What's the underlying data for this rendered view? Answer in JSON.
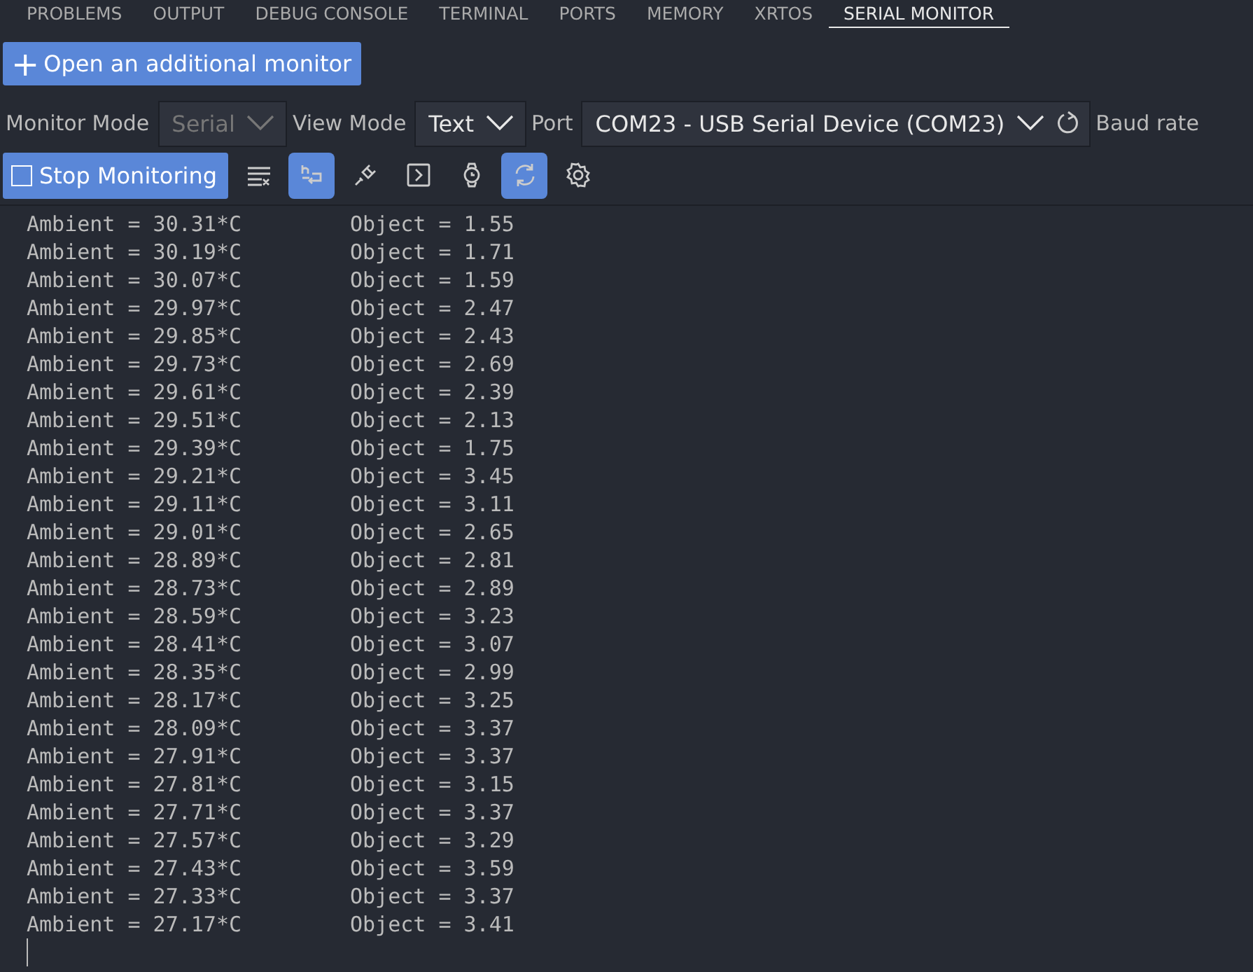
{
  "tabs": [
    {
      "label": "PROBLEMS",
      "selected": false
    },
    {
      "label": "OUTPUT",
      "selected": false
    },
    {
      "label": "DEBUG CONSOLE",
      "selected": false
    },
    {
      "label": "TERMINAL",
      "selected": false
    },
    {
      "label": "PORTS",
      "selected": false
    },
    {
      "label": "MEMORY",
      "selected": false
    },
    {
      "label": "XRTOS",
      "selected": false
    },
    {
      "label": "SERIAL MONITOR",
      "selected": true
    }
  ],
  "open_monitor_button": {
    "icon": "+",
    "label": "Open an additional monitor"
  },
  "settings": [
    {
      "label": "Monitor Mode",
      "value": "Serial",
      "disabled": true
    },
    {
      "label": "View Mode",
      "value": "Text",
      "disabled": false
    },
    {
      "label": "Port",
      "value": "COM23 - USB Serial Device (COM23)",
      "disabled": false,
      "refresh": true
    }
  ],
  "baud_label": "Baud rate",
  "stop_button": {
    "label": "Stop Monitoring"
  },
  "tools": [
    {
      "kind": "clear",
      "on": false
    },
    {
      "kind": "wrap",
      "on": true
    },
    {
      "kind": "plug",
      "on": false
    },
    {
      "kind": "terminal",
      "on": false
    },
    {
      "kind": "watch",
      "on": false
    },
    {
      "kind": "autoscroll",
      "on": true
    },
    {
      "kind": "settings",
      "on": false
    }
  ],
  "output": [
    {
      "ambient": "Ambient = 30.31*C",
      "object": "Object = 1.55"
    },
    {
      "ambient": "Ambient = 30.19*C",
      "object": "Object = 1.71"
    },
    {
      "ambient": "Ambient = 30.07*C",
      "object": "Object = 1.59"
    },
    {
      "ambient": "Ambient = 29.97*C",
      "object": "Object = 2.47"
    },
    {
      "ambient": "Ambient = 29.85*C",
      "object": "Object = 2.43"
    },
    {
      "ambient": "Ambient = 29.73*C",
      "object": "Object = 2.69"
    },
    {
      "ambient": "Ambient = 29.61*C",
      "object": "Object = 2.39"
    },
    {
      "ambient": "Ambient = 29.51*C",
      "object": "Object = 2.13"
    },
    {
      "ambient": "Ambient = 29.39*C",
      "object": "Object = 1.75"
    },
    {
      "ambient": "Ambient = 29.21*C",
      "object": "Object = 3.45"
    },
    {
      "ambient": "Ambient = 29.11*C",
      "object": "Object = 3.11"
    },
    {
      "ambient": "Ambient = 29.01*C",
      "object": "Object = 2.65"
    },
    {
      "ambient": "Ambient = 28.89*C",
      "object": "Object = 2.81"
    },
    {
      "ambient": "Ambient = 28.73*C",
      "object": "Object = 2.89"
    },
    {
      "ambient": "Ambient = 28.59*C",
      "object": "Object = 3.23"
    },
    {
      "ambient": "Ambient = 28.41*C",
      "object": "Object = 3.07"
    },
    {
      "ambient": "Ambient = 28.35*C",
      "object": "Object = 2.99"
    },
    {
      "ambient": "Ambient = 28.17*C",
      "object": "Object = 3.25"
    },
    {
      "ambient": "Ambient = 28.09*C",
      "object": "Object = 3.37"
    },
    {
      "ambient": "Ambient = 27.91*C",
      "object": "Object = 3.37"
    },
    {
      "ambient": "Ambient = 27.81*C",
      "object": "Object = 3.15"
    },
    {
      "ambient": "Ambient = 27.71*C",
      "object": "Object = 3.37"
    },
    {
      "ambient": "Ambient = 27.57*C",
      "object": "Object = 3.29"
    },
    {
      "ambient": "Ambient = 27.43*C",
      "object": "Object = 3.59"
    },
    {
      "ambient": "Ambient = 27.33*C",
      "object": "Object = 3.37"
    },
    {
      "ambient": "Ambient = 27.17*C",
      "object": "Object = 3.41"
    }
  ]
}
